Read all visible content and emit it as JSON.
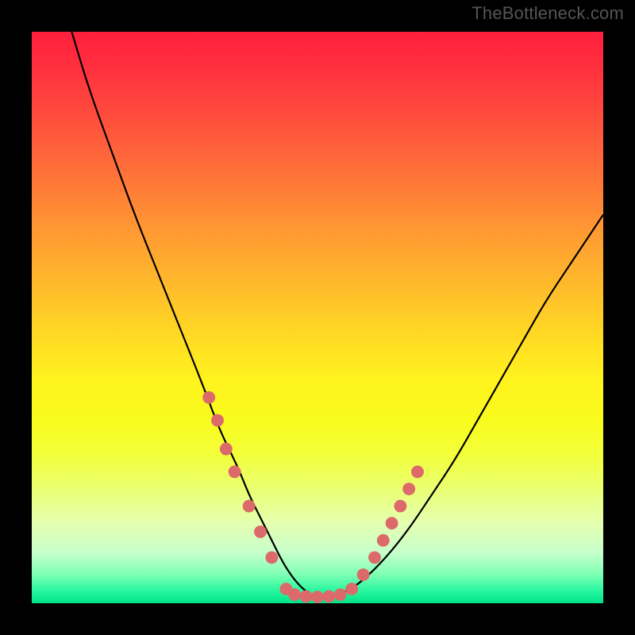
{
  "watermark": "TheBottleneck.com",
  "chart_data": {
    "type": "line",
    "title": "",
    "xlabel": "",
    "ylabel": "",
    "xlim": [
      0,
      100
    ],
    "ylim": [
      0,
      100
    ],
    "grid": false,
    "legend": false,
    "series": [
      {
        "name": "curve",
        "color": "#000000",
        "x": [
          7,
          10,
          14,
          18,
          22,
          26,
          30,
          33,
          36,
          38,
          40,
          42,
          44,
          46,
          48,
          50,
          52,
          55,
          58,
          62,
          66,
          70,
          74,
          78,
          82,
          86,
          90,
          94,
          98,
          100
        ],
        "y": [
          100,
          90,
          79,
          68,
          58,
          48,
          38,
          30,
          24,
          19,
          15,
          11,
          7,
          4,
          2,
          1,
          1,
          2,
          4,
          8,
          13,
          19,
          25,
          32,
          39,
          46,
          53,
          59,
          65,
          68
        ]
      }
    ],
    "markers": {
      "color": "#dd6a6a",
      "radius_pct": 1.1,
      "points_xy": [
        [
          31,
          36
        ],
        [
          32.5,
          32
        ],
        [
          34,
          27
        ],
        [
          35.5,
          23
        ],
        [
          38,
          17
        ],
        [
          40,
          12.5
        ],
        [
          42,
          8
        ],
        [
          44.5,
          2.5
        ],
        [
          46,
          1.5
        ],
        [
          48,
          1.2
        ],
        [
          50,
          1.1
        ],
        [
          52,
          1.2
        ],
        [
          54,
          1.5
        ],
        [
          56,
          2.5
        ],
        [
          58,
          5
        ],
        [
          60,
          8
        ],
        [
          61.5,
          11
        ],
        [
          63,
          14
        ],
        [
          64.5,
          17
        ],
        [
          66,
          20
        ],
        [
          67.5,
          23
        ]
      ]
    },
    "background_gradient_stops": [
      {
        "pos": 0,
        "color": "#ff1f3c"
      },
      {
        "pos": 24,
        "color": "#ff6f39"
      },
      {
        "pos": 53,
        "color": "#ffd924"
      },
      {
        "pos": 74,
        "color": "#f2ff3a"
      },
      {
        "pos": 91,
        "color": "#c8ffcb"
      },
      {
        "pos": 100,
        "color": "#00e28a"
      }
    ]
  }
}
